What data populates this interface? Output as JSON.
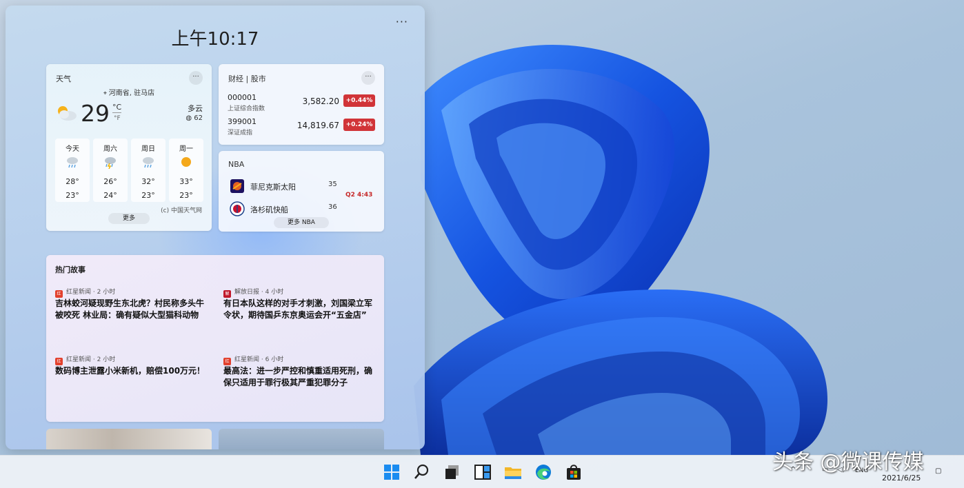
{
  "clock": {
    "time": "上午10:17"
  },
  "panel": {
    "menu_glyph": "···"
  },
  "weather": {
    "title": "天气",
    "location": "河南省, 驻马店",
    "temperature": "29",
    "unit_c": "°C",
    "unit_f": "°F",
    "condition": "多云",
    "aqi": "62",
    "forecast": [
      {
        "day": "今天",
        "icon": "cloud-rain-icon",
        "high": "28°",
        "low": "23°"
      },
      {
        "day": "周六",
        "icon": "thunderstorm-icon",
        "high": "26°",
        "low": "24°"
      },
      {
        "day": "周日",
        "icon": "cloud-rain-icon",
        "high": "32°",
        "low": "23°"
      },
      {
        "day": "周一",
        "icon": "sun-icon",
        "high": "33°",
        "low": "23°"
      }
    ],
    "source": "(c) 中国天气网",
    "more_label": "更多"
  },
  "stocks": {
    "title": "财经 | 股市",
    "items": [
      {
        "code": "000001",
        "name": "上证综合指数",
        "price": "3,582.20",
        "change": "+0.44%"
      },
      {
        "code": "399001",
        "name": "深证成指",
        "price": "14,819.67",
        "change": "+0.24%"
      }
    ],
    "change_color": "#d13438"
  },
  "nba": {
    "title": "NBA",
    "teams": [
      {
        "name": "菲尼克斯太阳",
        "score": "35",
        "logo": "suns-logo-icon"
      },
      {
        "name": "洛杉矶快船",
        "score": "36",
        "logo": "clippers-logo-icon"
      }
    ],
    "status": "Q2 4:43",
    "more_label": "更多 NBA"
  },
  "stories": {
    "title": "热门故事",
    "items": [
      {
        "source": "红星新闻",
        "time": "· 2 小时",
        "headline": "吉林蛟河疑现野生东北虎？村民称多头牛被咬死 林业局：确有疑似大型猫科动物"
      },
      {
        "source": "解放日报",
        "time": "· 4 小时",
        "headline": "有日本队这样的对手才刺激，刘国梁立军令状，期待国乒东京奥运会开“五金店”"
      },
      {
        "source": "红星新闻",
        "time": "· 2 小时",
        "headline": "数码博主泄露小米新机，赔偿100万元！"
      },
      {
        "source": "红星新闻",
        "time": "· 6 小时",
        "headline": "最高法：进一步严控和慎重适用死刑，确保只适用于罪行极其严重犯罪分子"
      }
    ]
  },
  "taskbar": {
    "icons": [
      "windows-start-icon",
      "search-icon",
      "task-view-icon",
      "widgets-icon",
      "file-explorer-icon",
      "edge-browser-icon",
      "store-icon"
    ],
    "tray_lang": "ENG",
    "date": "2021/6/25"
  },
  "watermark": "头条 @微课传媒"
}
